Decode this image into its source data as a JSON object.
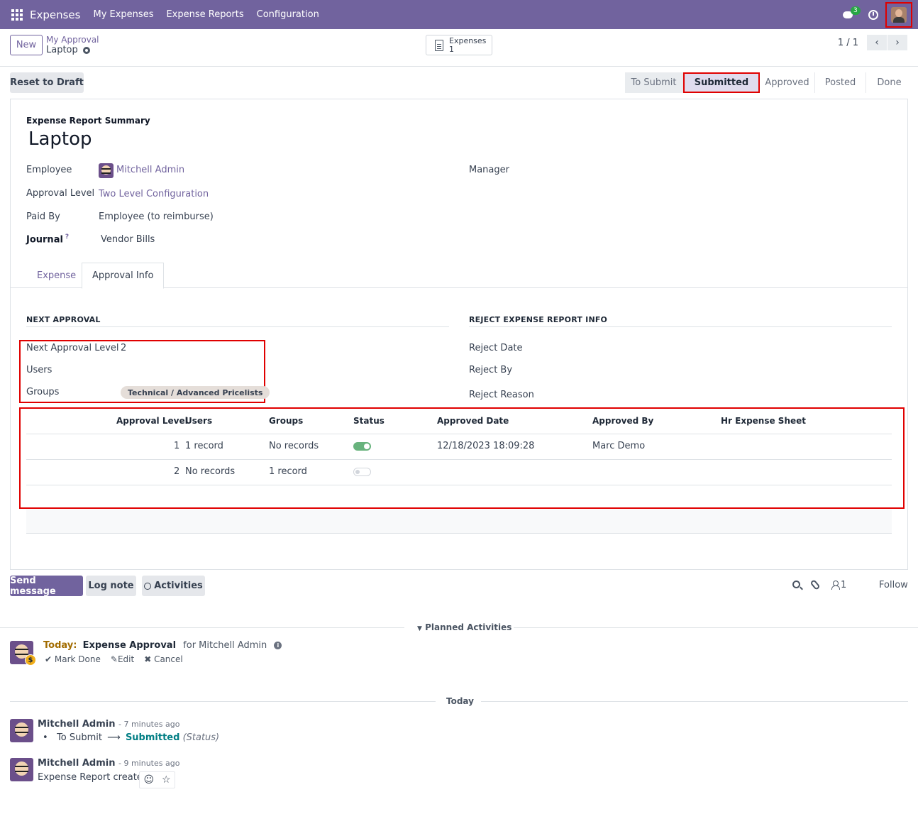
{
  "navbar": {
    "app_name": "Expenses",
    "menus": [
      "My Expenses",
      "Expense Reports",
      "Configuration"
    ],
    "chat_count": "3",
    "bg_color": "#71639e"
  },
  "control": {
    "new_label": "New",
    "breadcrumb_parent": "My Approval",
    "breadcrumb_current": "Laptop",
    "smart_button": {
      "label": "Expenses",
      "count": "1"
    },
    "pager": "1 / 1"
  },
  "statusbar": {
    "reset_label": "Reset to Draft",
    "stages": [
      "To Submit",
      "Submitted",
      "Approved",
      "Posted",
      "Done"
    ],
    "active_stage": "Submitted"
  },
  "form": {
    "summary_label": "Expense Report Summary",
    "title": "Laptop",
    "employee_label": "Employee",
    "employee_value": "Mitchell Admin",
    "manager_label": "Manager",
    "approval_level_label": "Approval Level",
    "approval_level_value": "Two Level Configuration",
    "paid_by_label": "Paid By",
    "paid_by_value": "Employee (to reimburse)",
    "journal_label": "Journal",
    "journal_help": "?",
    "journal_value": "Vendor Bills",
    "tabs": [
      "Expense",
      "Approval Info"
    ],
    "active_tab": "Approval Info"
  },
  "approval_info": {
    "next_approval_title": "NEXT APPROVAL",
    "next_level_label": "Next Approval Level",
    "next_level_value": "2",
    "users_label": "Users",
    "groups_label": "Groups",
    "group_tag": "Technical / Advanced Pricelists",
    "reject_title": "REJECT EXPENSE REPORT INFO",
    "reject_date_label": "Reject Date",
    "reject_by_label": "Reject By",
    "reject_reason_label": "Reject Reason"
  },
  "table": {
    "headers": [
      "Approval Level",
      "Users",
      "Groups",
      "Status",
      "Approved Date",
      "Approved By",
      "Hr Expense Sheet"
    ],
    "rows": [
      {
        "level": "1",
        "users": "1 record",
        "groups": "No records",
        "status": true,
        "date": "12/18/2023 18:09:28",
        "by": "Marc Demo",
        "sheet": ""
      },
      {
        "level": "2",
        "users": "No records",
        "groups": "1 record",
        "status": false,
        "date": "",
        "by": "",
        "sheet": ""
      }
    ]
  },
  "chatter": {
    "send_label": "Send message",
    "log_label": "Log note",
    "activities_label": "Activities",
    "followers_count": "1",
    "follow_label": "Follow",
    "planned_label": "Planned Activities",
    "activity": {
      "due": "Today:",
      "summary": "Expense Approval",
      "assignee": "for Mitchell Admin",
      "mark_done": "Mark Done",
      "edit": "Edit",
      "cancel": "Cancel"
    },
    "date_separator": "Today",
    "messages": [
      {
        "author": "Mitchell Admin",
        "time": "- 7 minutes ago",
        "old_value": "To Submit",
        "arrow": "⟶",
        "new_value": "Submitted",
        "field": "(Status)"
      },
      {
        "author": "Mitchell Admin",
        "time": "- 9 minutes ago",
        "body": "Expense Report created"
      }
    ]
  }
}
